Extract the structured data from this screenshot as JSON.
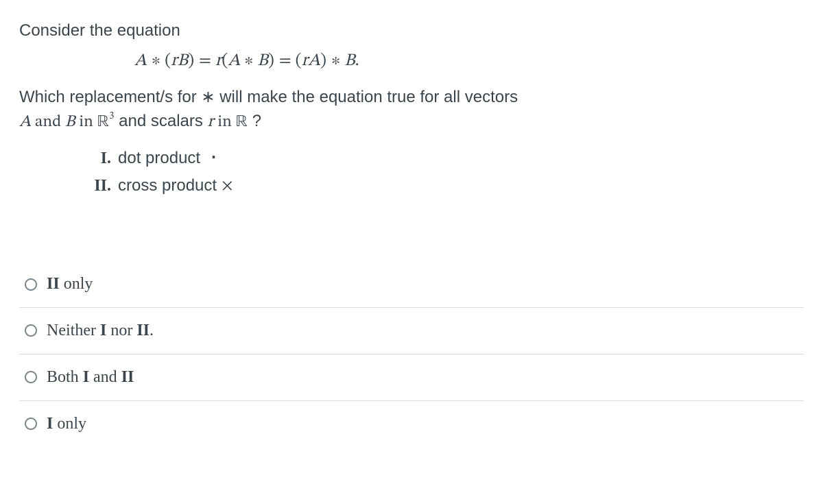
{
  "question": {
    "intro": "Consider the equation",
    "equation": "A ∗ (rB) = r(A ∗ B) = (rA) ∗ B.",
    "prompt_part1": "Which replacement/s for ∗ will make the equation true for all vectors",
    "prompt_A": "A",
    "prompt_and": " and ",
    "prompt_B": "B",
    "prompt_in": " in ",
    "prompt_R3": "ℝ",
    "prompt_exp": "3",
    "prompt_scalars": " and scalars  ",
    "prompt_r": "r",
    "prompt_inR": " in ",
    "prompt_R": "ℝ",
    "prompt_q": " ?",
    "options": [
      {
        "numeral": "I.",
        "text": "dot product",
        "symbol": "·"
      },
      {
        "numeral": "II.",
        "text": "cross product",
        "symbol": "×"
      }
    ]
  },
  "answers": [
    {
      "pre": "",
      "bold": "II",
      "post": " only"
    },
    {
      "pre": "Neither ",
      "bold": "I",
      "mid": " nor ",
      "bold2": "II",
      "post": "."
    },
    {
      "pre": "Both ",
      "bold": "I",
      "mid": " and ",
      "bold2": "II",
      "post": ""
    },
    {
      "pre": "",
      "bold": "I",
      "post": " only"
    }
  ]
}
